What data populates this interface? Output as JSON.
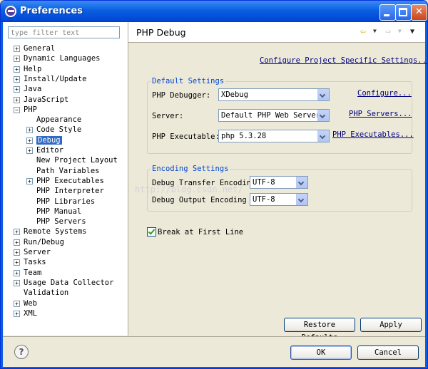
{
  "window": {
    "title": "Preferences"
  },
  "filter": {
    "placeholder": "type filter text"
  },
  "tree": [
    {
      "label": "General",
      "indent": 0,
      "expander": "+"
    },
    {
      "label": "Dynamic Languages",
      "indent": 0,
      "expander": "+"
    },
    {
      "label": "Help",
      "indent": 0,
      "expander": "+"
    },
    {
      "label": "Install/Update",
      "indent": 0,
      "expander": "+"
    },
    {
      "label": "Java",
      "indent": 0,
      "expander": "+"
    },
    {
      "label": "JavaScript",
      "indent": 0,
      "expander": "+"
    },
    {
      "label": "PHP",
      "indent": 0,
      "expander": "-"
    },
    {
      "label": "Appearance",
      "indent": 1,
      "expander": ""
    },
    {
      "label": "Code Style",
      "indent": 1,
      "expander": "+"
    },
    {
      "label": "Debug",
      "indent": 1,
      "expander": "+",
      "selected": true
    },
    {
      "label": "Editor",
      "indent": 1,
      "expander": "+"
    },
    {
      "label": "New Project Layout",
      "indent": 1,
      "expander": ""
    },
    {
      "label": "Path Variables",
      "indent": 1,
      "expander": ""
    },
    {
      "label": "PHP Executables",
      "indent": 1,
      "expander": "+"
    },
    {
      "label": "PHP Interpreter",
      "indent": 1,
      "expander": ""
    },
    {
      "label": "PHP Libraries",
      "indent": 1,
      "expander": ""
    },
    {
      "label": "PHP Manual",
      "indent": 1,
      "expander": ""
    },
    {
      "label": "PHP Servers",
      "indent": 1,
      "expander": ""
    },
    {
      "label": "Remote Systems",
      "indent": 0,
      "expander": "+"
    },
    {
      "label": "Run/Debug",
      "indent": 0,
      "expander": "+"
    },
    {
      "label": "Server",
      "indent": 0,
      "expander": "+"
    },
    {
      "label": "Tasks",
      "indent": 0,
      "expander": "+"
    },
    {
      "label": "Team",
      "indent": 0,
      "expander": "+"
    },
    {
      "label": "Usage Data Collector",
      "indent": 0,
      "expander": "+"
    },
    {
      "label": "Validation",
      "indent": 0,
      "expander": ""
    },
    {
      "label": "Web",
      "indent": 0,
      "expander": "+"
    },
    {
      "label": "XML",
      "indent": 0,
      "expander": "+"
    }
  ],
  "page": {
    "title": "PHP Debug",
    "configure_project_link": "Configure Project Specific Settings...",
    "default_settings": {
      "title": "Default Settings",
      "debugger_label": "PHP Debugger:",
      "debugger_value": "XDebug",
      "debugger_link": "Configure...",
      "server_label": "Server:",
      "server_value": "Default PHP Web Server",
      "server_link": "PHP Servers...",
      "executable_label": "PHP Executable:",
      "executable_value": "php 5.3.28",
      "executable_link": "PHP Executables..."
    },
    "encoding_settings": {
      "title": "Encoding Settings",
      "transfer_label": "Debug Transfer Encoding",
      "transfer_value": "UTF-8",
      "output_label": "Debug Output Encoding",
      "output_value": "UTF-8"
    },
    "break_first_line": {
      "label": "Break at First Line",
      "checked": true
    },
    "restore_defaults": "Restore Defaults",
    "apply": "Apply"
  },
  "footer": {
    "ok": "OK",
    "cancel": "Cancel"
  },
  "watermark": "http://blog.csdn.net/"
}
